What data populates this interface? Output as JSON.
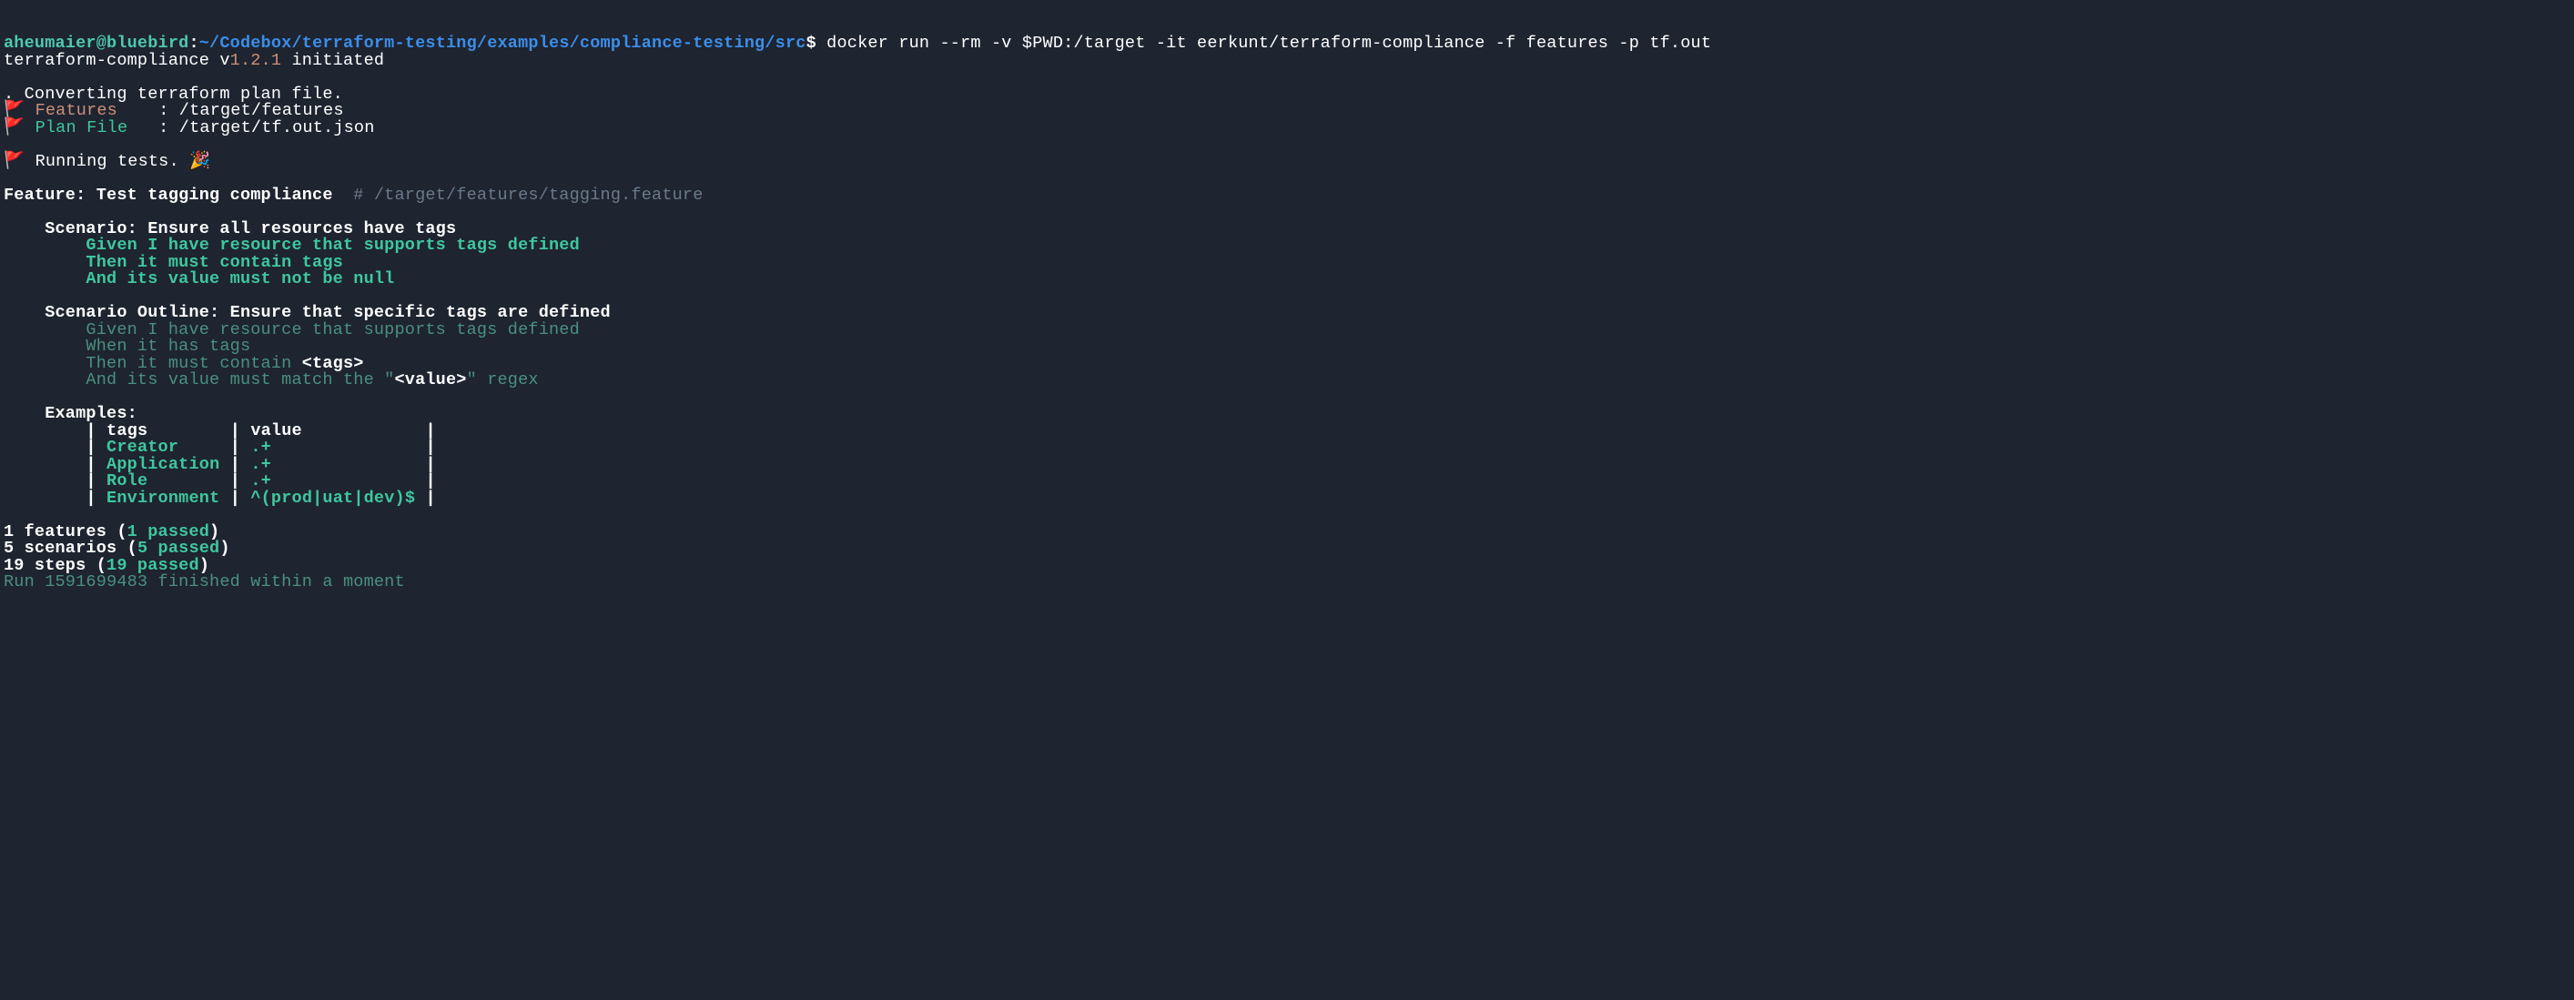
{
  "prompt": {
    "user": "aheumaier@bluebird",
    "colon1": ":",
    "path": "~/Codebox/terraform-testing/examples/compliance-testing/src",
    "dollar": "$",
    "command": " docker run --rm -v $PWD:/target -it eerkunt/terraform-compliance -f features -p tf.out"
  },
  "init": {
    "prefix": "terraform-compliance v",
    "version": "1.2.1",
    "suffix": " initiated"
  },
  "converting": ". Converting terraform plan file.",
  "flag": "🚩",
  "features_label": "Features",
  "features_sep": "    : ",
  "features_path": "/target/features",
  "planfile_label": "Plan File",
  "planfile_sep": "   : ",
  "planfile_path": "/target/tf.out.json",
  "running_tests": "Running tests. ",
  "party": "🎉",
  "feature_line": {
    "kw": "Feature: Test tagging compliance ",
    "hash": " # ",
    "path": "/target/features/tagging.feature"
  },
  "scenario1": {
    "title": "    Scenario: Ensure all resources have tags",
    "given": "        Given I have resource that supports tags defined",
    "then": "        Then it must contain tags",
    "and": "        And its value must not be null"
  },
  "scenario2": {
    "title": "    Scenario Outline: Ensure that specific tags are defined",
    "given": "        Given I have resource that supports tags defined",
    "when": "        When it has tags",
    "then_p": "        Then it must contain ",
    "then_t": "<tags>",
    "and_p": "        And its value must match the \"",
    "and_v": "<value>",
    "and_s": "\" regex"
  },
  "examples_label": "    Examples:",
  "examples": {
    "h_tags": "tags",
    "h_value": "value",
    "r1_tag": "Creator",
    "r1_val": ".+",
    "r2_tag": "Application",
    "r2_val": ".+",
    "r3_tag": "Role",
    "r3_val": ".+",
    "r4_tag": "Environment",
    "r4_val": "^(prod|uat|dev)$"
  },
  "table": {
    "header": "        | tags        | value            |",
    "r1": "        | Creator     | .+               |",
    "r2": "        | Application | .+               |",
    "r3": "        | Role        | .+               |",
    "r4": "        | Environment | ^(prod|uat|dev)$ |"
  },
  "summary": {
    "feat_a": "1 features (",
    "feat_b": "1 passed",
    "feat_c": ")",
    "scen_a": "5 scenarios (",
    "scen_b": "5 passed",
    "scen_c": ")",
    "step_a": "19 steps (",
    "step_b": "19 passed",
    "step_c": ")",
    "run": "Run 1591699483 finished within a moment"
  }
}
